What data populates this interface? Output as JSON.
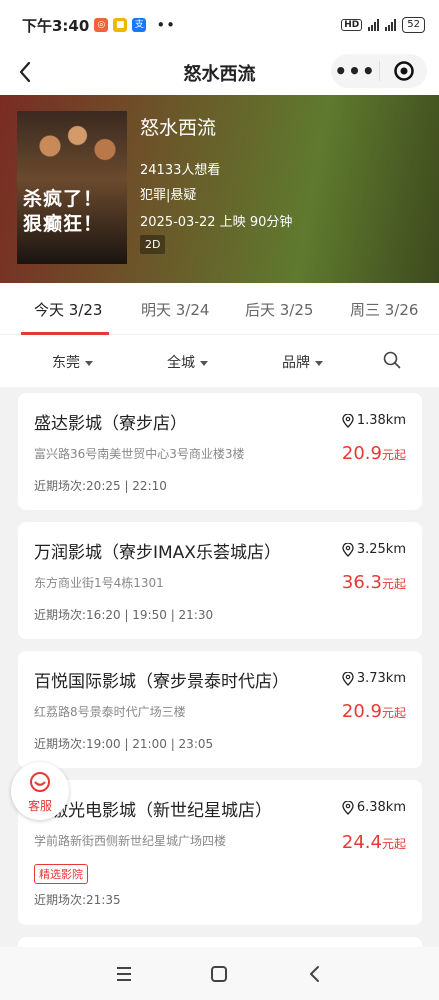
{
  "status_bar": {
    "time": "下午3:40",
    "network": "HD 5G",
    "battery": "52"
  },
  "nav": {
    "title": "怒水西流",
    "more_label": "•••"
  },
  "movie": {
    "title": "怒水西流",
    "poster_text_1": "杀疯了！",
    "poster_text_2": "狠癫狂！",
    "want_to_see": "24133人想看",
    "genre": "犯罪|悬疑",
    "release": "2025-03-22 上映 90分钟",
    "format": "2D"
  },
  "date_tabs": [
    {
      "label": "今天 3/23",
      "active": true
    },
    {
      "label": "明天 3/24",
      "active": false
    },
    {
      "label": "后天 3/25",
      "active": false
    },
    {
      "label": "周三 3/26",
      "active": false
    }
  ],
  "filters": {
    "city": "东莞",
    "area": "全城",
    "brand": "品牌"
  },
  "cinemas": [
    {
      "name": "盛达影城（寮步店）",
      "distance": "1.38km",
      "address": "富兴路36号南美世贸中心3号商业楼3楼",
      "price": "20.9",
      "price_suffix": "元起",
      "showtimes": "近期场次:20:25 | 22:10"
    },
    {
      "name": "万润影城（寮步IMAX乐荟城店）",
      "distance": "3.25km",
      "address": "东方商业街1号4栋1301",
      "price": "36.3",
      "price_suffix": "元起",
      "showtimes": "近期场次:16:20 | 19:50 | 21:30"
    },
    {
      "name": "百悦国际影城（寮步景泰时代店）",
      "distance": "3.73km",
      "address": "红荔路8号景泰时代广场三楼",
      "price": "20.9",
      "price_suffix": "元起",
      "showtimes": "近期场次:19:00 | 21:00 | 23:05"
    },
    {
      "name": "百激光电影城（新世纪星城店）",
      "distance": "6.38km",
      "address": "学前路新街西侧新世纪星城广场四楼",
      "price": "24.4",
      "price_suffix": "元起",
      "tag": "精选影院",
      "showtimes": "近期场次:21:35"
    }
  ],
  "customer_service": {
    "label": "客服"
  },
  "colors": {
    "accent": "#e53935"
  }
}
